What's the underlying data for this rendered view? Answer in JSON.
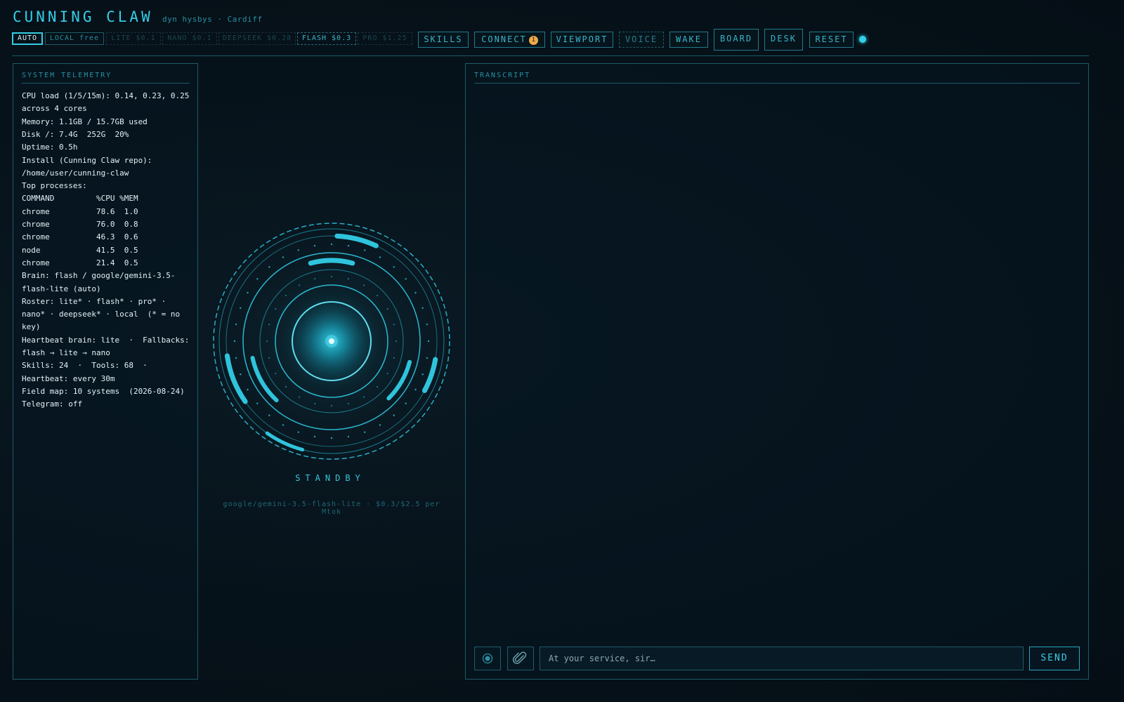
{
  "header": {
    "title": "CUNNING CLAW",
    "subtitle": "dyn hysbys · Cardiff"
  },
  "model_pills": [
    {
      "label": "AUTO",
      "state": "active"
    },
    {
      "label": "LOCAL free",
      "state": "normal"
    },
    {
      "label": "LITE $0.1",
      "state": "dim"
    },
    {
      "label": "NANO $0.1",
      "state": "dim"
    },
    {
      "label": "DEEPSEEK $0.28",
      "state": "dim"
    },
    {
      "label": "FLASH $0.3",
      "state": "selected"
    },
    {
      "label": "PRO $1.25",
      "state": "dim"
    }
  ],
  "buttons": {
    "skills": "SKILLS",
    "connect": "CONNECT",
    "connect_badge": "1",
    "viewport": "VIEWPORT",
    "voice": "VOICE",
    "wake": "WAKE",
    "board": "BOARD",
    "desk": "DESK",
    "reset": "RESET"
  },
  "status_dot_color": "#32d0ea",
  "telemetry": {
    "title": "SYSTEM TELEMETRY",
    "lines": [
      "CPU load (1/5/15m): 0.14, 0.23, 0.25",
      "across 4 cores",
      "Memory: 1.1GB / 15.7GB used",
      "Disk /: 7.4G  252G  20%",
      "Uptime: 0.5h",
      "Install (Cunning Claw repo):",
      "/home/user/cunning-claw",
      "Top processes:",
      "COMMAND         %CPU %MEM",
      "chrome          78.6  1.0",
      "chrome          76.0  0.8",
      "chrome          46.3  0.6",
      "node            41.5  0.5",
      "chrome          21.4  0.5",
      "Brain: flash / google/gemini-3.5-",
      "flash-lite (auto)",
      "Roster: lite* · flash* · pro* ·",
      "nano* · deepseek* · local  (* = no",
      "key)",
      "Heartbeat brain: lite  ·  Fallbacks:",
      "flash → lite → nano",
      "Skills: 24  ·  Tools: 68  ·",
      "Heartbeat: every 30m",
      "Field map: 10 systems  (2026-08-24)",
      "Telegram: off"
    ]
  },
  "core": {
    "status": "STANDBY",
    "model_line_1": "google/gemini-3.5-flash-lite · $0.3/$2.5 per",
    "model_line_2": "Mtok"
  },
  "transcript": {
    "title": "TRANSCRIPT",
    "input_placeholder": "At your service, sir…",
    "send_label": "SEND",
    "mic_icon": "record-icon",
    "attach_icon": "paperclip-icon"
  },
  "colors": {
    "accent": "#35cde6",
    "badge": "#f0a848",
    "text": "#e3f2f6"
  }
}
